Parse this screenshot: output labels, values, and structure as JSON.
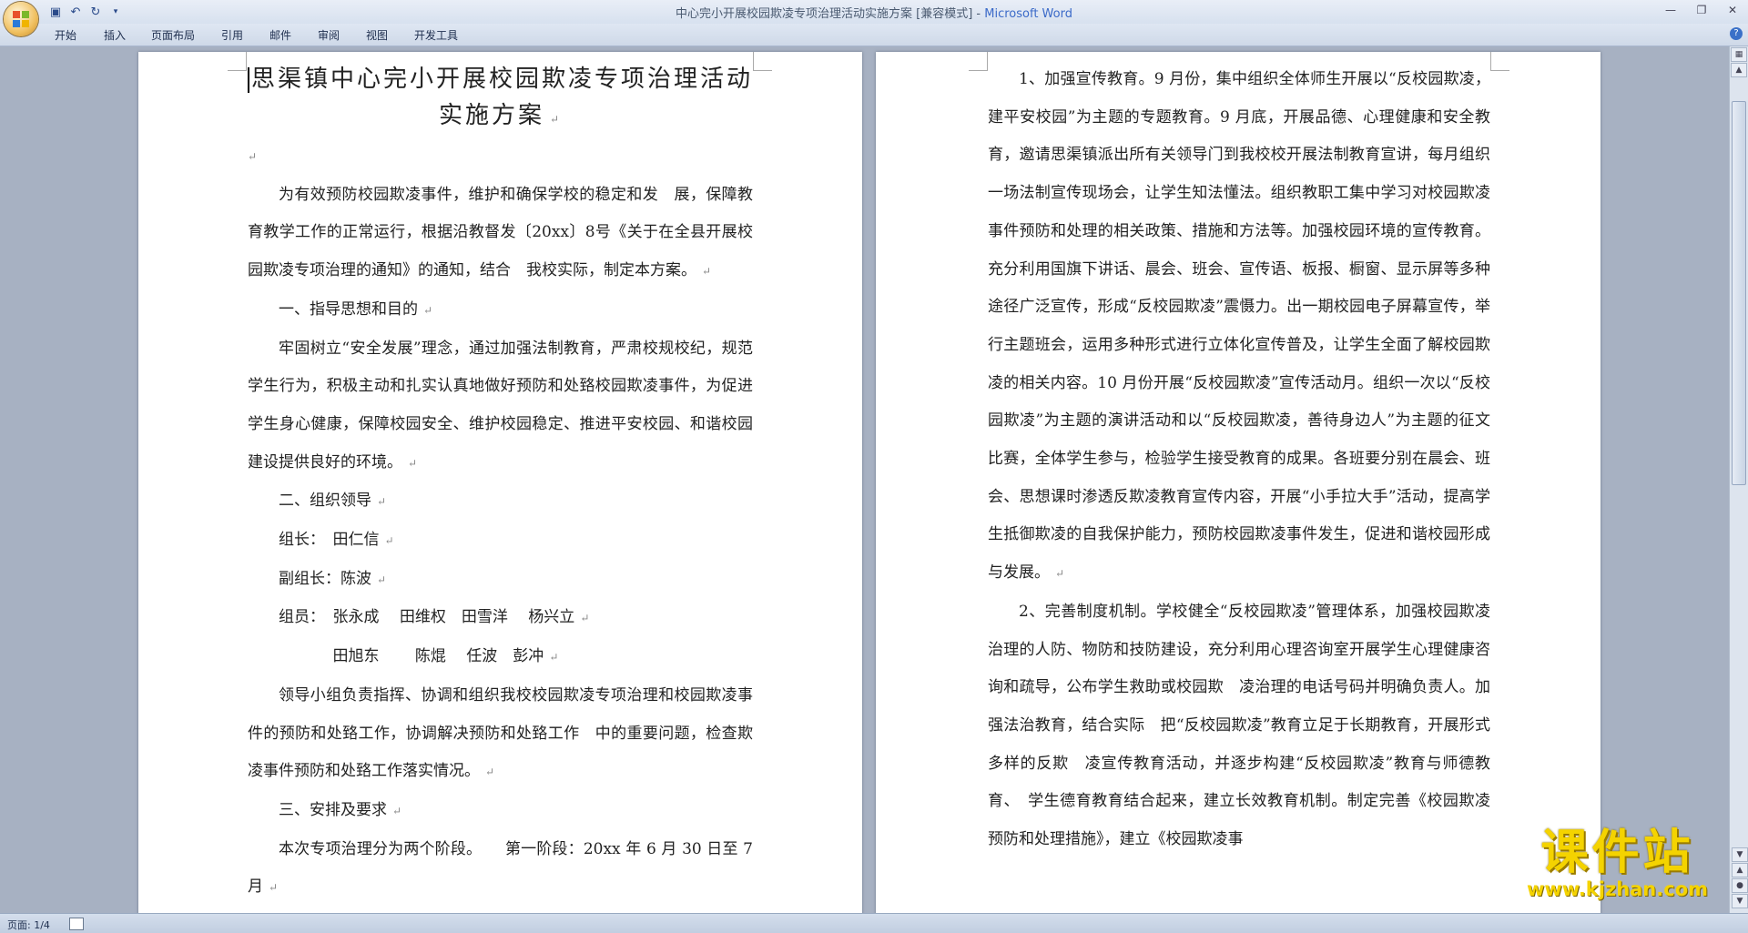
{
  "window": {
    "title": "中心完小开展校园欺凌专项治理活动实施方案 [兼容模式] - ",
    "app_name": "Microsoft Word"
  },
  "qat": {
    "save_icon": "save-icon",
    "undo_icon": "undo-icon",
    "redo_icon": "redo-icon",
    "customize_icon": "dropdown-icon"
  },
  "tabs": [
    "开始",
    "插入",
    "页面布局",
    "引用",
    "邮件",
    "审阅",
    "视图",
    "开发工具"
  ],
  "left_page": {
    "title": "思渠镇中心完小开展校园欺凌专项治理活动实施方案",
    "p1": "为有效预防校园欺凌事件，维护和确保学校的稳定和发　展，保障教育教学工作的正常运行，根据沿教督发〔20xx〕8号《关于在全县开展校园欺凌专项治理的通知》的通知，结合　我校实际，制定本方案。",
    "h1": "一、指导思想和目的",
    "p2": "牢固树立“安全发展”理念，通过加强法制教育，严肃校规校纪，规范学生行为，积极主动和扎实认真地做好预防和处臵校园欺凌事件，为促进学生身心健康，保障校园安全、维护校园稳定、推进平安校园、和谐校园建设提供良好的环境。",
    "h2": "二、组织领导",
    "leader": "组长：　田仁信",
    "vice_leader": "副组长：陈波",
    "members1": "组员：　张永成　 田维权　田雪洋　 杨兴立",
    "members2": "田旭东　　 陈焜　 任波　彭冲",
    "p3": "领导小组负责指挥、协调和组织我校校园欺凌专项治理和校园欺凌事件的预防和处臵工作，协调解决预防和处臵工作　中的重要问题，检查欺凌事件预防和处臵工作落实情况。",
    "h3": "三、安排及要求",
    "p4": "本次专项治理分为两个阶段。　　第一阶段：20xx 年 6 月 30 日至 7 月"
  },
  "right_page": {
    "p1": "1、加强宣传教育。9 月份，集中组织全体师生开展以“反校园欺凌，建平安校园”为主题的专题教育。9 月底，开展品德、心理健康和安全教育，邀请思渠镇派出所有关领导门到我校校开展法制教育宣讲，每月组织一场法制宣传现场会，让学生知法懂法。组织教职工集中学习对校园欺凌事件预防和处理的相关政策、措施和方法等。加强校园环境的宣传教育。充分利用国旗下讲话、晨会、班会、宣传语、板报、橱窗、显示屏等多种途径广泛宣传，形成“反校园欺凌”震慑力。出一期校园电子屏幕宣传，举行主题班会，运用多种形式进行立体化宣传普及，让学生全面了解校园欺凌的相关内容。10 月份开展“反校园欺凌”宣传活动月。组织一次以“反校园欺凌”为主题的演讲活动和以“反校园欺凌，善待身边人”为主题的征文比赛，全体学生参与，检验学生接受教育的成果。各班要分别在晨会、班会、思想课时渗透反欺凌教育宣传内容，开展“小手拉大手”活动，提高学生抵御欺凌的自我保护能力，预防校园欺凌事件发生，促进和谐校园形成与发展。",
    "p2": "2、完善制度机制。学校健全“反校园欺凌”管理体系，加强校园欺凌治理的人防、物防和技防建设，充分利用心理咨询室开展学生心理健康咨询和疏导，公布学生救助或校园欺　凌治理的电话号码并明确负责人。加强法治教育，结合实际　把“反校园欺凌”教育立足于长期教育，开展形式多样的反欺　凌宣传教育活动，并逐步构建“反校园欺凌”教育与师德教育、　学生德育教育结合起来，建立长效教育机制。制定完善《校园欺凌预防和处理措施》，建立《校园欺凌事"
  },
  "status": {
    "page_info": "页面: 1/4"
  },
  "watermark": {
    "main": "课件站",
    "url": "www.kjzhan.com"
  }
}
